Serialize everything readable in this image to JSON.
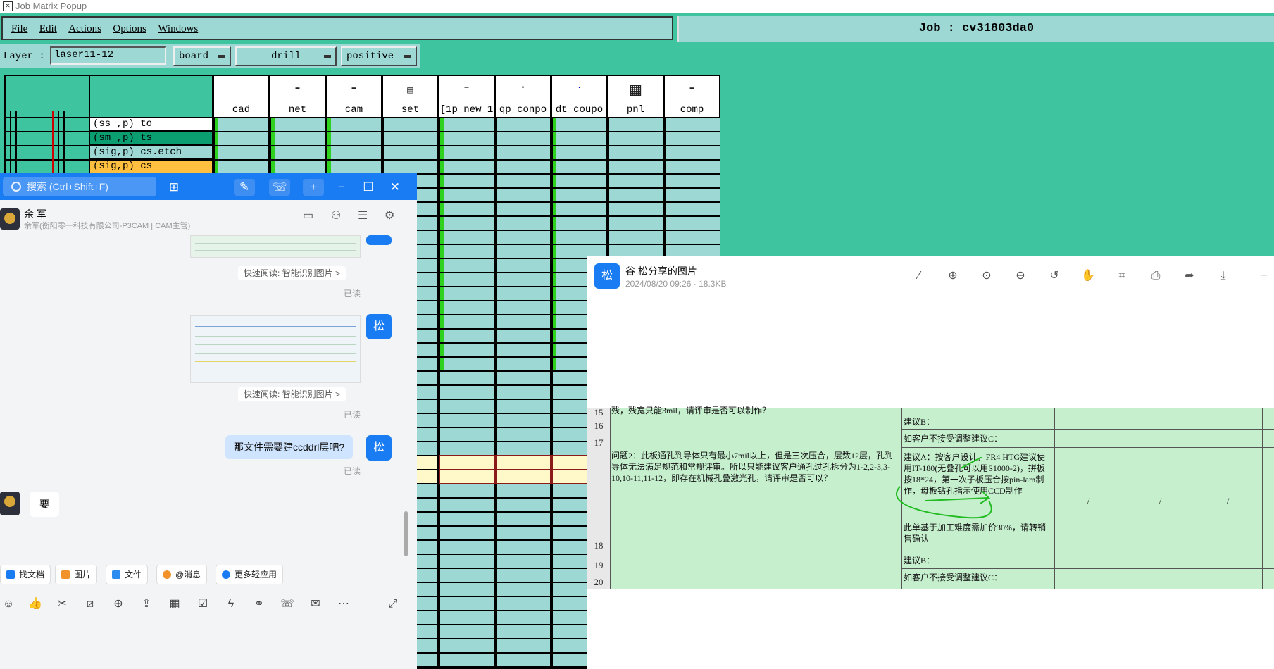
{
  "window": {
    "title": "Job Matrix Popup"
  },
  "menu": {
    "items": [
      "File",
      "Edit",
      "Actions",
      "Options",
      "Windows"
    ]
  },
  "job": {
    "label": "Job  :  cv31803da0"
  },
  "layer_bar": {
    "label": "Layer :",
    "value": "laser11-12",
    "context": "board",
    "type": "drill",
    "polarity": "positive"
  },
  "matrix": {
    "columns": [
      "cad",
      "net",
      "cam",
      "set",
      "[1p_new_1",
      "qp_conpo",
      "dt_coupo",
      "pnl",
      "comp"
    ],
    "rows": [
      {
        "label": "(ss ,p) to",
        "color": "#ffffff"
      },
      {
        "label": "(sm ,p) ts",
        "color": "#0a9e70"
      },
      {
        "label": "(sig,p) cs.etch",
        "color": "#9dd8d5"
      },
      {
        "label": "(sig,p) cs",
        "color": "#ffbf3f"
      }
    ]
  },
  "chat": {
    "search_placeholder": "搜索 (Ctrl+Shift+F)",
    "contact_name": "余 军",
    "contact_sub": "余军(衡阳零一科技有限公司-P3CAM | CAM主管)",
    "quick_read": "快速阅读: 智能识别图片 >",
    "read": "已读",
    "message_me": "那文件需要建ccddrl层吧?",
    "my_avatar": "松",
    "reply": "要",
    "tools": [
      "找文档",
      "图片",
      "文件",
      "@消息",
      "更多轻应用"
    ]
  },
  "viewer": {
    "avatar": "松",
    "title": "谷 松分享的图片",
    "meta": "2024/08/20 09:26 · 18.3KB",
    "sheet": {
      "row_numbers": [
        "15",
        "16",
        "17",
        "18",
        "19",
        "20"
      ],
      "top_text": "残，残宽只能3mil，请评审是否可以制作？",
      "question": "问题2：此板通孔到导体只有最小7mil以上，但是三次压合，层数12层，孔到导体无法满足规范和常规评审。所以只能建议客户通孔过孔拆分为1-2,2-3,3-10,10-11,11-12，即存在机械孔叠激光孔，请评审是否可以？",
      "suggest_b": "建议B：",
      "suggest_c": "如客户不接受调整建议C：",
      "suggest_a": "建议A：按客户设计，FR4 HTG建议使用IT-180(无叠孔可以用S1000-2)，拼板按18*24，第一次子板压合按pin-lam制作，母板钻孔指示使用CCD制作",
      "price_note": "此单基于加工难度需加价30%，请转销售确认",
      "slashes": [
        "/",
        "/",
        "/"
      ]
    }
  }
}
